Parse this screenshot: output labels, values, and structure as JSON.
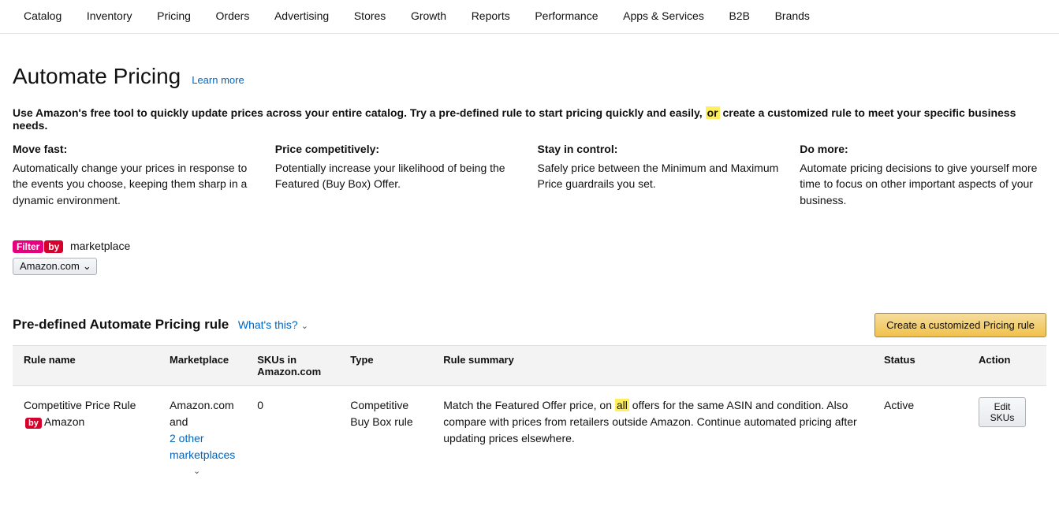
{
  "nav": [
    "Catalog",
    "Inventory",
    "Pricing",
    "Orders",
    "Advertising",
    "Stores",
    "Growth",
    "Reports",
    "Performance",
    "Apps & Services",
    "B2B",
    "Brands"
  ],
  "page": {
    "title": "Automate Pricing",
    "learn": "Learn more"
  },
  "intro": {
    "pre": "Use Amazon's free tool to quickly update prices across your entire catalog. Try a pre-defined rule to start pricing quickly and easily, ",
    "hl": "or",
    "post": " create a customized rule to meet your specific business needs."
  },
  "benefits": [
    {
      "h": "Move fast:",
      "p": "Automatically change your prices in response to the events you choose, keeping them sharp in a dynamic environment."
    },
    {
      "h": "Price competitively:",
      "p": "Potentially increase your likelihood of being the Featured (Buy Box) Offer."
    },
    {
      "h": "Stay in control:",
      "p": "Safely price between the Minimum and Maximum Price guardrails you set."
    },
    {
      "h": "Do more:",
      "p": "Automate pricing decisions to give yourself more time to focus on other important aspects of your business."
    }
  ],
  "filter": {
    "pill1": "Filter",
    "pill2": "by",
    "label": "marketplace",
    "selected": "Amazon.com"
  },
  "section": {
    "title": "Pre-defined Automate Pricing rule",
    "whats": "What's this?",
    "createBtn": "Create a customized Pricing rule"
  },
  "table": {
    "headers": {
      "rule": "Rule name",
      "market": "Marketplace",
      "skus": "SKUs in Amazon.com",
      "type": "Type",
      "summary": "Rule summary",
      "status": "Status",
      "action": "Action"
    },
    "row": {
      "rule_a": "Competitive Price Rule",
      "rule_pill": "by",
      "rule_b": "Amazon",
      "market_a": "Amazon.com and",
      "market_link": "2 other marketplaces",
      "skus": "0",
      "type": "Competitive Buy Box rule",
      "summary_a": "Match the Featured Offer price, on ",
      "summary_hl": "all",
      "summary_b": " offers for the same ASIN and condition. Also compare with prices from retailers outside Amazon. Continue automated pricing after updating prices elsewhere.",
      "status": "Active",
      "actionBtn": "Edit SKUs"
    }
  }
}
